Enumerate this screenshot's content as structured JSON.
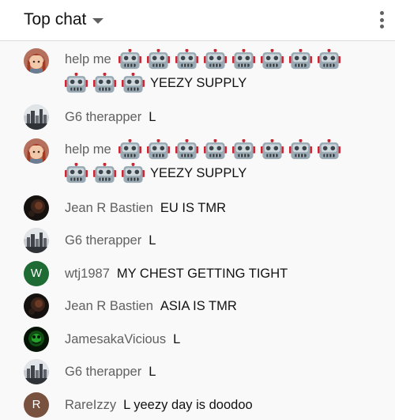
{
  "header": {
    "title": "Top chat"
  },
  "colors": {
    "background": "#f9f9f9",
    "author": "#606060",
    "text": "#111111",
    "avatar_w": "#1e6b34",
    "avatar_r": "#79513f"
  },
  "messages": [
    {
      "author": "help me",
      "emoji_count": 11,
      "emoji_icon": "robot-face-icon",
      "text": "YEEZY SUPPLY",
      "avatar": "anime-avatar"
    },
    {
      "author": "G6 therapper",
      "text": "L",
      "avatar": "skyline-avatar"
    },
    {
      "author": "help me",
      "emoji_count": 11,
      "emoji_icon": "robot-face-icon",
      "text": "YEEZY SUPPLY",
      "avatar": "anime-avatar"
    },
    {
      "author": "Jean R Bastien",
      "text": "EU IS TMR",
      "avatar": "dark-avatar"
    },
    {
      "author": "G6 therapper",
      "text": "L",
      "avatar": "skyline-avatar"
    },
    {
      "author": "wtj1987",
      "text": "MY CHEST GETTING TIGHT",
      "avatar_letter": "W"
    },
    {
      "author": "Jean R Bastien",
      "text": "ASIA IS TMR",
      "avatar": "dark-avatar"
    },
    {
      "author": "JamesakaVicious",
      "text": "L",
      "avatar": "green-avatar"
    },
    {
      "author": "G6 therapper",
      "text": "L",
      "avatar": "skyline-avatar"
    },
    {
      "author": "RareIzzy",
      "text": "L yeezy day is doodoo",
      "avatar_letter": "R"
    }
  ]
}
